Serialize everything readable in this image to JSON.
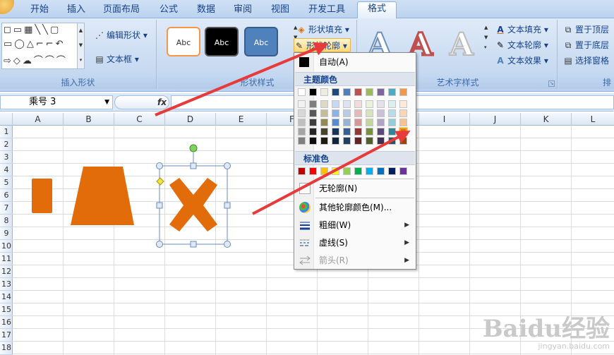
{
  "tabs": [
    {
      "label": "开始",
      "active": false
    },
    {
      "label": "插入",
      "active": false
    },
    {
      "label": "页面布局",
      "active": false
    },
    {
      "label": "公式",
      "active": false
    },
    {
      "label": "数据",
      "active": false
    },
    {
      "label": "审阅",
      "active": false
    },
    {
      "label": "视图",
      "active": false
    },
    {
      "label": "开发工具",
      "active": false
    },
    {
      "label": "格式",
      "active": true
    }
  ],
  "ribbon": {
    "insert_shapes": {
      "label": "插入形状",
      "edit_shape": "编辑形状",
      "text_box": "文本框"
    },
    "shape_styles": {
      "label": "形状样式",
      "thumb_text": "Abc",
      "fill": "形状填充",
      "outline": "形状轮廓",
      "effect_hint": "形"
    },
    "wordart": {
      "label": "艺术字样式",
      "letter": "A",
      "text_fill": "文本填充",
      "text_outline": "文本轮廓",
      "text_effect": "文本效果"
    },
    "arrange": {
      "bring_front": "置于顶层",
      "send_back": "置于底层",
      "selection_pane": "选择窗格",
      "label": "排"
    }
  },
  "formula_bar": {
    "name_box": "乘号 3",
    "fx": "fx",
    "content": ""
  },
  "columns": [
    "A",
    "B",
    "C",
    "D",
    "E",
    "F",
    "G",
    "H",
    "I",
    "J",
    "K",
    "L"
  ],
  "rows": [
    "1",
    "2",
    "3",
    "4",
    "5",
    "6",
    "7",
    "8",
    "9",
    "10",
    "11",
    "12",
    "13",
    "14",
    "15",
    "16",
    "17",
    "18"
  ],
  "outline_menu": {
    "auto": "自动(A)",
    "theme_colors_header": "主题颜色",
    "standard_colors_header": "标准色",
    "no_outline": "无轮廓(N)",
    "more_colors": "其他轮廓颜色(M)...",
    "weight": "粗细(W)",
    "dashes": "虚线(S)",
    "arrows": "箭头(R)",
    "theme_colors": [
      [
        "#ffffff",
        "#000000",
        "#eeece1",
        "#1f497d",
        "#4f81bd",
        "#c0504d",
        "#9bbb59",
        "#8064a2",
        "#4bacc6",
        "#f79646"
      ],
      [
        "#f2f2f2",
        "#7f7f7f",
        "#ddd9c3",
        "#c6d9f0",
        "#dbe5f1",
        "#f2dcdb",
        "#ebf1dd",
        "#e5e0ec",
        "#dbeef3",
        "#fdeada"
      ],
      [
        "#d8d8d8",
        "#595959",
        "#c4bd97",
        "#8db3e2",
        "#b8cce4",
        "#e5b9b7",
        "#d7e3bc",
        "#ccc1d9",
        "#b7dde8",
        "#fbd5b5"
      ],
      [
        "#bfbfbf",
        "#3f3f3f",
        "#938953",
        "#548dd4",
        "#95b3d7",
        "#d99694",
        "#c3d69b",
        "#b2a2c7",
        "#92cddc",
        "#fac08f"
      ],
      [
        "#a5a5a5",
        "#262626",
        "#494429",
        "#17365d",
        "#366092",
        "#953734",
        "#76923c",
        "#5f497a",
        "#31859b",
        "#e36c09"
      ],
      [
        "#7f7f7f",
        "#0c0c0c",
        "#1d1b10",
        "#0f243e",
        "#244061",
        "#632423",
        "#4f6128",
        "#3f3151",
        "#205867",
        "#974806"
      ]
    ],
    "standard_colors": [
      "#c00000",
      "#ff0000",
      "#ffc000",
      "#ffff00",
      "#92d050",
      "#00b050",
      "#00b0f0",
      "#0070c0",
      "#002060",
      "#7030a0"
    ],
    "highlighted_color": "#e36c09"
  },
  "shapes_color": "#e36c0a",
  "watermark": {
    "brand": "Baidu经验",
    "url": "jingyan.baidu.com"
  }
}
